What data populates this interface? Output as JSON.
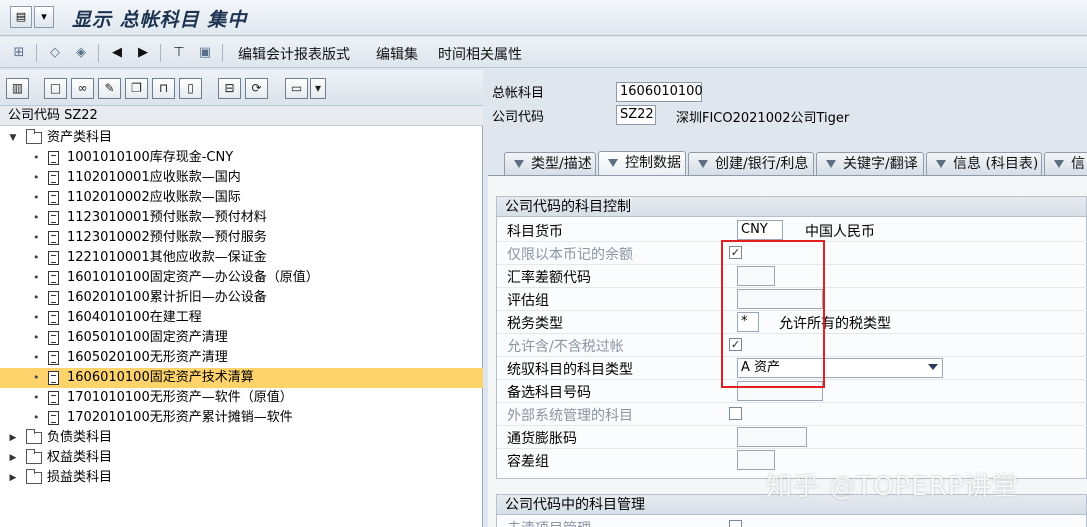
{
  "window": {
    "title": "显示 总帐科目 集中"
  },
  "toolbar": {
    "edit_report_format": "编辑会计报表版式",
    "edit_set": "编辑集",
    "time_attributes": "时间相关属性"
  },
  "left": {
    "header": "公司代码 SZ22",
    "tree": {
      "asset_folder": "资产类科目",
      "items": [
        "1001010100库存现金-CNY",
        "1102010001应收账款—国内",
        "1102010002应收账款—国际",
        "1123010001预付账款—预付材料",
        "1123010002预付账款—预付服务",
        "1221010001其他应收款—保证金",
        "1601010100固定资产—办公设备（原值）",
        "1602010100累计折旧—办公设备",
        "1604010100在建工程",
        "1605010100固定资产清理",
        "1605020100无形资产清理",
        "1606010100固定资产技术清算",
        "1701010100无形资产—软件（原值）",
        "1702010100无形资产累计摊销—软件"
      ],
      "folders": [
        "负债类科目",
        "权益类科目",
        "损益类科目"
      ]
    }
  },
  "right": {
    "gl_account_label": "总帐科目",
    "gl_account_value": "1606010100",
    "company_code_label": "公司代码",
    "company_code_value": "SZ22",
    "company_name": "深圳FICO2021002公司Tiger",
    "tabs": [
      "类型/描述",
      "控制数据",
      "创建/银行/利息",
      "关键字/翻译",
      "信息 (科目表)",
      "信息"
    ],
    "group1": {
      "title": "公司代码的科目控制",
      "fields": {
        "currency_label": "科目货币",
        "currency_value": "CNY",
        "currency_text": "中国人民币",
        "local_only_label": "仅限以本币记的余额",
        "local_only_check": "✓",
        "exch_diff_label": "汇率差额代码",
        "valuation_label": "评估组",
        "tax_cat_label": "税务类型",
        "tax_cat_value": "*",
        "tax_cat_text": "允许所有的税类型",
        "posting_wo_tax_label": "允许含/不含税过帐",
        "posting_wo_tax_check": "✓",
        "recon_label": "统驭科目的科目类型",
        "recon_value": "A 资产",
        "alt_acct_label": "备选科目号码",
        "ext_mgmt_label": "外部系统管理的科目",
        "inflation_label": "通货膨胀码",
        "tolerance_label": "容差组"
      }
    },
    "group2": {
      "title": "公司代码中的科目管理",
      "first_field": "未清项目管理"
    }
  },
  "watermark": "知乎 @TOPERP讲堂"
}
